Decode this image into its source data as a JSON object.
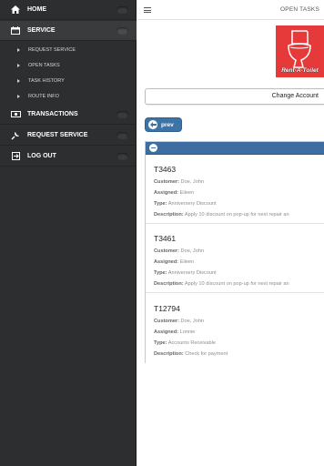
{
  "sidebar": {
    "items": [
      {
        "label": "HOME",
        "icon": "home-icon"
      },
      {
        "label": "SERVICE",
        "icon": "calendar-icon"
      },
      {
        "label": "TRANSACTIONS",
        "icon": "money-icon"
      },
      {
        "label": "REQUEST SERVICE",
        "icon": "plunger-icon"
      },
      {
        "label": "LOG OUT",
        "icon": "logout-icon"
      }
    ],
    "service_subitems": [
      {
        "label": "REQUEST SERVICE"
      },
      {
        "label": "OPEN TASKS"
      },
      {
        "label": "TASK HISTORY"
      },
      {
        "label": "ROUTE INFO"
      }
    ]
  },
  "header": {
    "title": "OPEN TASKS"
  },
  "logo": {
    "text": "Rent-A-Toilet"
  },
  "account": {
    "change_label": "Change Account"
  },
  "pager": {
    "prev_label": "prev"
  },
  "field_labels": {
    "customer": "Customer:",
    "assigned": "Assigned:",
    "type": "Type:",
    "description": "Description:"
  },
  "tasks": [
    {
      "id": "T3463",
      "customer": "Doe, John",
      "assigned": "Eileen",
      "type": "Anniversery Discount",
      "description": "Apply 10 discount on pop-up for next repair an"
    },
    {
      "id": "T3461",
      "customer": "Doe, John",
      "assigned": "Eileen",
      "type": "Anniversery Discount",
      "description": "Apply 10 discount on pop-up for next repair an"
    },
    {
      "id": "T12794",
      "customer": "Doe, John",
      "assigned": "Lonnie",
      "type": "Accounts Receivable",
      "description": "Check for payment"
    }
  ],
  "colors": {
    "sidebar_bg": "#2d2e30",
    "accent_blue": "#3e6ea1",
    "logo_red": "#e63a3a"
  }
}
